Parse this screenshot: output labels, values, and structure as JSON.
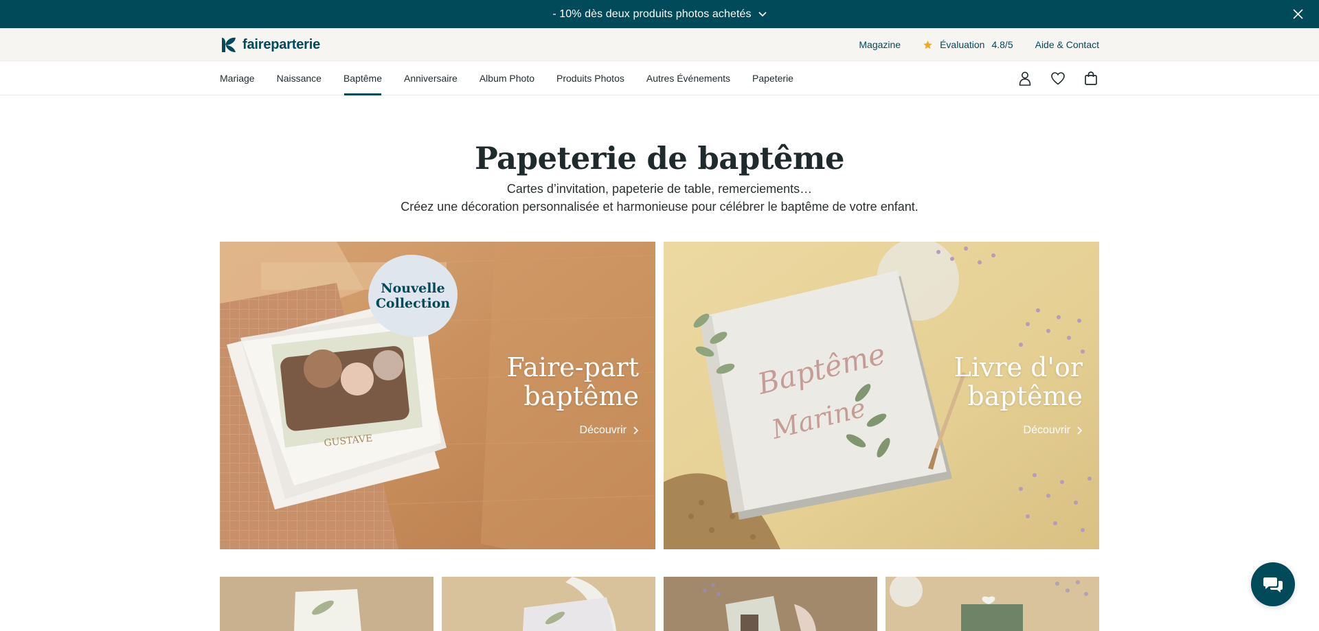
{
  "promo": {
    "text": "- 10% dès deux produits photos achetés"
  },
  "brand": {
    "name": "faireparterie",
    "color": "#004a5a"
  },
  "utility": {
    "magazine": "Magazine",
    "rating_label": "Évaluation",
    "rating_value": "4.8/5",
    "help": "Aide & Contact"
  },
  "nav": {
    "items": [
      {
        "label": "Mariage"
      },
      {
        "label": "Naissance"
      },
      {
        "label": "Baptême",
        "active": true
      },
      {
        "label": "Anniversaire"
      },
      {
        "label": "Album Photo"
      },
      {
        "label": "Produits Photos"
      },
      {
        "label": "Autres Événements"
      },
      {
        "label": "Papeterie"
      }
    ]
  },
  "hero": {
    "title": "Papeterie de baptême",
    "subtitle_line1": "Cartes d’invitation, papeterie de table, remerciements…",
    "subtitle_line2": "Créez une décoration personnalisée et harmonieuse pour célébrer le baptême de votre enfant."
  },
  "cards": [
    {
      "title_line1": "Faire-part",
      "title_line2": "baptême",
      "cta": "Découvrir",
      "badge_line1": "Nouvelle",
      "badge_line2": "Collection"
    },
    {
      "title_line1": "Livre d'or",
      "title_line2": "baptême",
      "cta": "Découvrir"
    }
  ],
  "icons": {
    "promo_chevron": "chevron-down-icon",
    "close": "close-icon",
    "rating": "star-icon",
    "account": "user-icon",
    "wishlist": "heart-icon",
    "cart": "bag-icon",
    "chat": "chat-icon"
  },
  "colors": {
    "promo_bg": "#004a5a",
    "utility_bg": "#f6f5f2",
    "star": "#f2a81d"
  }
}
